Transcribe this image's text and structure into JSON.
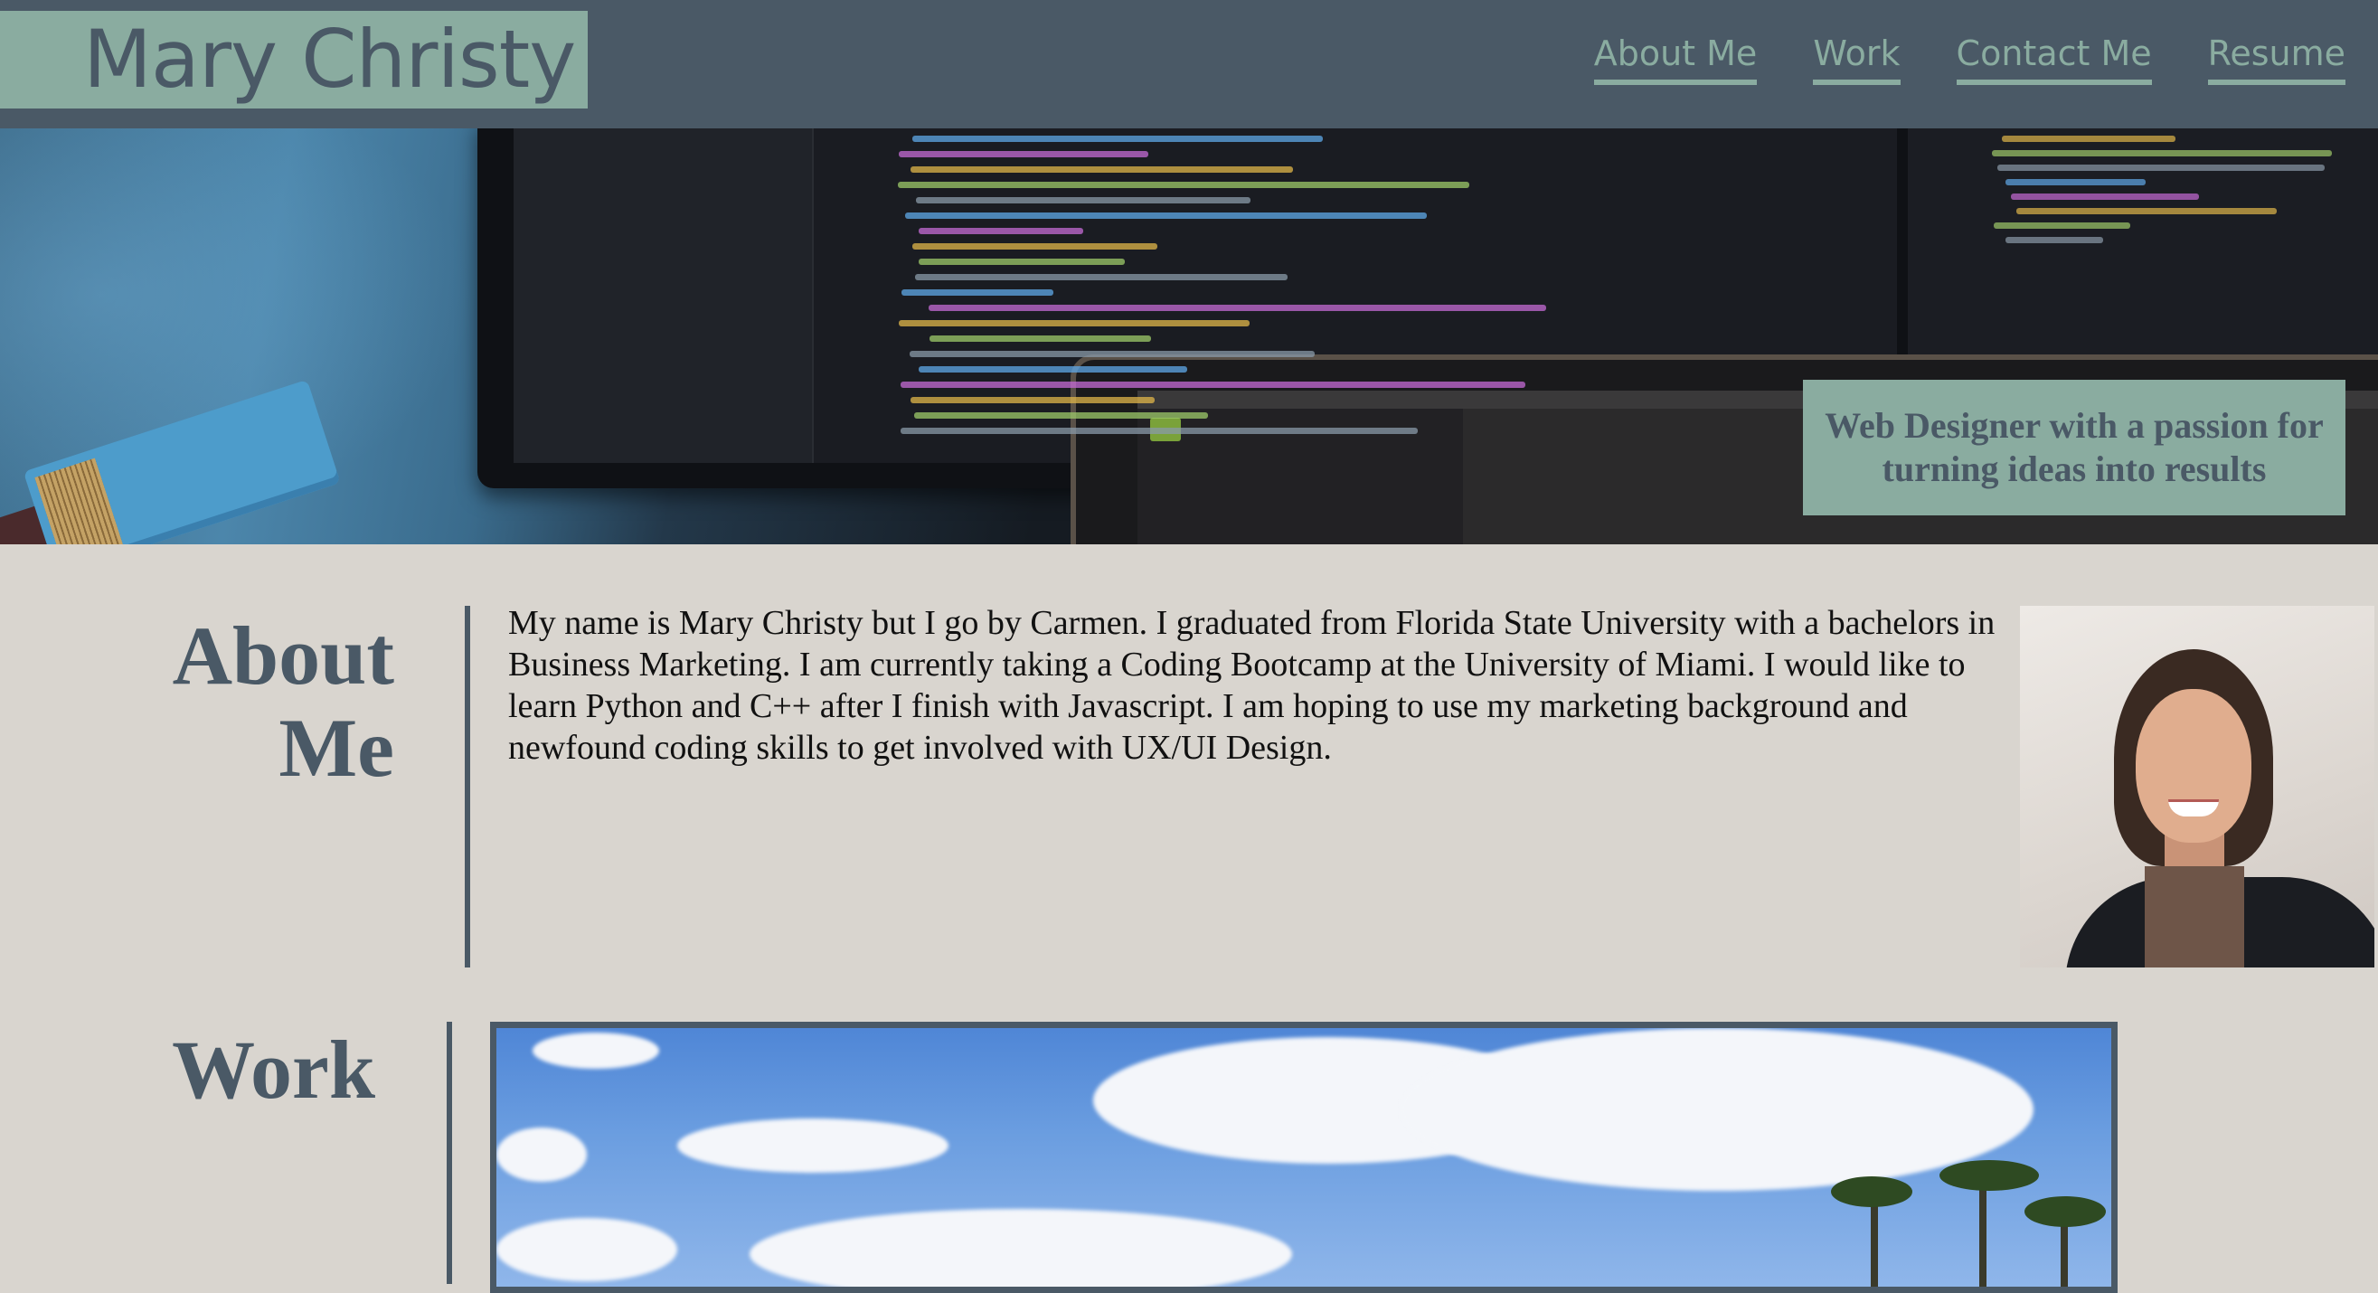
{
  "header": {
    "brand": "Mary Christy",
    "nav": [
      {
        "label": "About Me"
      },
      {
        "label": "Work"
      },
      {
        "label": "Contact Me"
      },
      {
        "label": "Resume"
      }
    ]
  },
  "hero": {
    "tagline": "Web Designer with a passion for turning ideas into results"
  },
  "about": {
    "title": "About Me",
    "body": "My name is Mary Christy but I go by Carmen. I graduated from Florida State University with a bachelors in Business Marketing. I am currently taking a Coding Bootcamp at the University of Miami. I would like to learn Python and C++ after I finish with Javascript. I am hoping to use my marketing background and newfound coding skills to get involved with UX/UI Design."
  },
  "work": {
    "title": "Work"
  },
  "colors": {
    "header_bg": "#4a5966",
    "accent": "#8aaca0",
    "page_bg": "#d9d5cf",
    "text_dark": "#4a5966"
  }
}
